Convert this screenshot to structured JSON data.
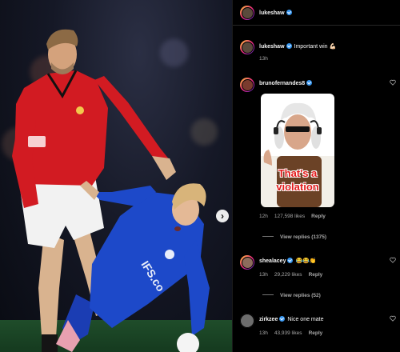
{
  "post": {
    "author": "lukeshaw",
    "media_next_icon": "chevron-right-icon"
  },
  "comments": [
    {
      "user": "lukeshaw",
      "text": "Important win 💪🏻",
      "time": "13h"
    },
    {
      "user": "brunofernandes8",
      "sticker_text_line1": "That's a",
      "sticker_text_line2": "violation",
      "time": "12h",
      "likes": "127,598 likes",
      "reply": "Reply",
      "view_replies": "View replies (1375)"
    },
    {
      "user": "shealacey",
      "text": "😂😂👏",
      "time": "13h",
      "likes": "29,229 likes",
      "reply": "Reply",
      "view_replies": "View replies (52)"
    },
    {
      "user": "zirkzee",
      "text": "Nice one mate",
      "time": "13h",
      "likes": "43,939 likes",
      "reply": "Reply"
    }
  ],
  "colors": {
    "verified": "#3897f0",
    "sticker_text": "#e21b1b"
  }
}
